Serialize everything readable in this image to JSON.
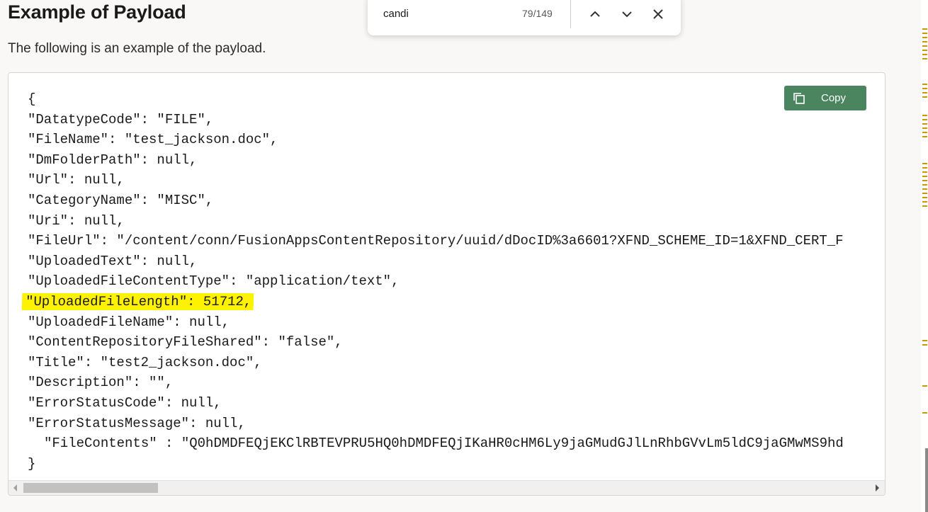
{
  "heading": "Example of Payload",
  "intro": "The following is an example of the payload.",
  "copy_button": {
    "label": "Copy",
    "icon": "copy-icon"
  },
  "find_bar": {
    "query": "candi",
    "count": "79/149"
  },
  "code_lines": [
    {
      "text": "{",
      "indent": false,
      "highlight": false
    },
    {
      "text": "\"DatatypeCode\": \"FILE\",",
      "indent": false,
      "highlight": false
    },
    {
      "text": "\"FileName\": \"test_jackson.doc\",",
      "indent": false,
      "highlight": false
    },
    {
      "text": "\"DmFolderPath\": null,",
      "indent": false,
      "highlight": false
    },
    {
      "text": "\"Url\": null,",
      "indent": false,
      "highlight": false
    },
    {
      "text": "\"CategoryName\": \"MISC\",",
      "indent": false,
      "highlight": false
    },
    {
      "text": "\"Uri\": null,",
      "indent": false,
      "highlight": false
    },
    {
      "text": "\"FileUrl\": \"/content/conn/FusionAppsContentRepository/uuid/dDocID%3a6601?XFND_SCHEME_ID=1&XFND_CERT_F",
      "indent": false,
      "highlight": false
    },
    {
      "text": "\"UploadedText\": null,",
      "indent": false,
      "highlight": false
    },
    {
      "text": "\"UploadedFileContentType\": \"application/text\",",
      "indent": false,
      "highlight": false
    },
    {
      "text": "\"UploadedFileLength\": 51712,",
      "indent": false,
      "highlight": true
    },
    {
      "text": "\"UploadedFileName\": null,",
      "indent": false,
      "highlight": false
    },
    {
      "text": "\"ContentRepositoryFileShared\": \"false\",",
      "indent": false,
      "highlight": false
    },
    {
      "text": "\"Title\": \"test2_jackson.doc\",",
      "indent": false,
      "highlight": false
    },
    {
      "text": "\"Description\": \"\",",
      "indent": false,
      "highlight": false
    },
    {
      "text": "\"ErrorStatusCode\": null,",
      "indent": false,
      "highlight": false
    },
    {
      "text": "\"ErrorStatusMessage\": null,",
      "indent": false,
      "highlight": false
    },
    {
      "text": "\"FileContents\" : \"Q0hDMDFEQjEKClRBTEVPRU5HQ0hDMDFEQjIKaHR0cHM6Ly9jaGMudGJlLnRhbGVvLm5ldC9jaGMwMS9hd",
      "indent": true,
      "highlight": false
    },
    {
      "text": "}",
      "indent": false,
      "highlight": false
    }
  ],
  "colors": {
    "copy_button": "#4a8560",
    "highlight": "#fff200",
    "match_marker": "#c99a00"
  }
}
